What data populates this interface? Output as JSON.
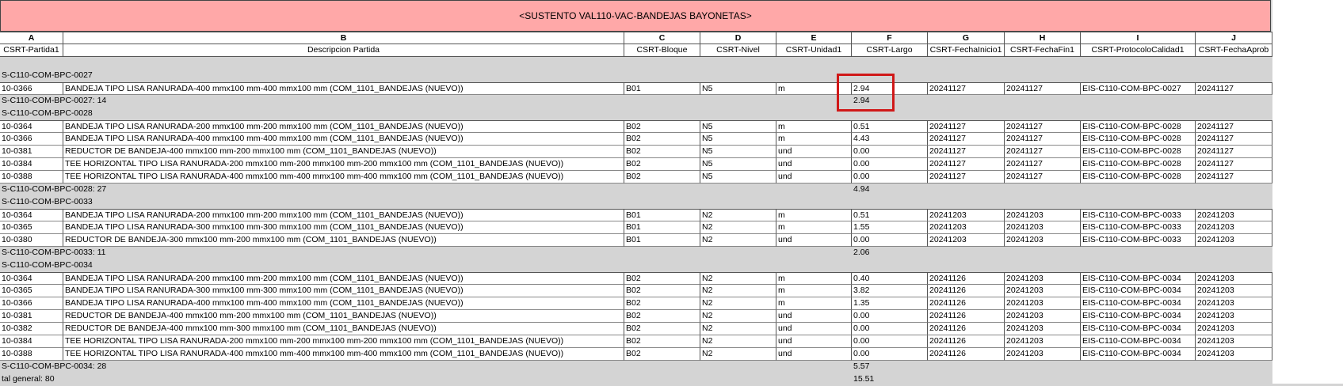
{
  "title": "<SUSTENTO VAL110-VAC-BANDEJAS BAYONETAS>",
  "column_letters": [
    "A",
    "B",
    "C",
    "D",
    "E",
    "F",
    "G",
    "H",
    "I",
    "J"
  ],
  "column_headers": [
    "CSRT-Partida1",
    "Descripcion Partida",
    "CSRT-Bloque",
    "CSRT-Nivel",
    "CSRT-Unidad1",
    "CSRT-Largo",
    "CSRT-FechaInicio1",
    "CSRT-FechaFin1",
    "CSRT-ProtocoloCalidad1",
    "CSRT-FechaAprob"
  ],
  "groups": [
    {
      "header": "S-C110-COM-BPC-0027",
      "rows": [
        [
          "10-0366",
          "BANDEJA TIPO LISA RANURADA-400 mmx100 mm-400 mmx100 mm (COM_1101_BANDEJAS (NUEVO))",
          "B01",
          "N5",
          "m",
          "2.94",
          "20241127",
          "20241127",
          "EIS-C110-COM-BPC-0027",
          "20241127"
        ]
      ],
      "subtotal_label": "S-C110-COM-BPC-0027: 14",
      "subtotal_value": "2.94"
    },
    {
      "header": "S-C110-COM-BPC-0028",
      "rows": [
        [
          "10-0364",
          "BANDEJA TIPO LISA RANURADA-200 mmx100 mm-200 mmx100 mm (COM_1101_BANDEJAS (NUEVO))",
          "B02",
          "N5",
          "m",
          "0.51",
          "20241127",
          "20241127",
          "EIS-C110-COM-BPC-0028",
          "20241127"
        ],
        [
          "10-0366",
          "BANDEJA TIPO LISA RANURADA-400 mmx100 mm-400 mmx100 mm (COM_1101_BANDEJAS (NUEVO))",
          "B02",
          "N5",
          "m",
          "4.43",
          "20241127",
          "20241127",
          "EIS-C110-COM-BPC-0028",
          "20241127"
        ],
        [
          "10-0381",
          "REDUCTOR DE BANDEJA-400 mmx100 mm-200 mmx100 mm (COM_1101_BANDEJAS (NUEVO))",
          "B02",
          "N5",
          "und",
          "0.00",
          "20241127",
          "20241127",
          "EIS-C110-COM-BPC-0028",
          "20241127"
        ],
        [
          "10-0384",
          "TEE HORIZONTAL TIPO LISA RANURADA-200 mmx100 mm-200 mmx100 mm-200 mmx100 mm (COM_1101_BANDEJAS (NUEVO))",
          "B02",
          "N5",
          "und",
          "0.00",
          "20241127",
          "20241127",
          "EIS-C110-COM-BPC-0028",
          "20241127"
        ],
        [
          "10-0388",
          "TEE HORIZONTAL TIPO LISA RANURADA-400 mmx100 mm-400 mmx100 mm-400 mmx100 mm (COM_1101_BANDEJAS (NUEVO))",
          "B02",
          "N5",
          "und",
          "0.00",
          "20241127",
          "20241127",
          "EIS-C110-COM-BPC-0028",
          "20241127"
        ]
      ],
      "subtotal_label": "S-C110-COM-BPC-0028: 27",
      "subtotal_value": "4.94"
    },
    {
      "header": "S-C110-COM-BPC-0033",
      "rows": [
        [
          "10-0364",
          "BANDEJA TIPO LISA RANURADA-200 mmx100 mm-200 mmx100 mm (COM_1101_BANDEJAS (NUEVO))",
          "B01",
          "N2",
          "m",
          "0.51",
          "20241203",
          "20241203",
          "EIS-C110-COM-BPC-0033",
          "20241203"
        ],
        [
          "10-0365",
          "BANDEJA TIPO LISA RANURADA-300 mmx100 mm-300 mmx100 mm (COM_1101_BANDEJAS (NUEVO))",
          "B01",
          "N2",
          "m",
          "1.55",
          "20241203",
          "20241203",
          "EIS-C110-COM-BPC-0033",
          "20241203"
        ],
        [
          "10-0380",
          "REDUCTOR DE BANDEJA-300 mmx100 mm-200 mmx100 mm (COM_1101_BANDEJAS (NUEVO))",
          "B01",
          "N2",
          "und",
          "0.00",
          "20241203",
          "20241203",
          "EIS-C110-COM-BPC-0033",
          "20241203"
        ]
      ],
      "subtotal_label": "S-C110-COM-BPC-0033: 11",
      "subtotal_value": "2.06"
    },
    {
      "header": "S-C110-COM-BPC-0034",
      "rows": [
        [
          "10-0364",
          "BANDEJA TIPO LISA RANURADA-200 mmx100 mm-200 mmx100 mm (COM_1101_BANDEJAS (NUEVO))",
          "B02",
          "N2",
          "m",
          "0.40",
          "20241126",
          "20241203",
          "EIS-C110-COM-BPC-0034",
          "20241203"
        ],
        [
          "10-0365",
          "BANDEJA TIPO LISA RANURADA-300 mmx100 mm-300 mmx100 mm (COM_1101_BANDEJAS (NUEVO))",
          "B02",
          "N2",
          "m",
          "3.82",
          "20241126",
          "20241203",
          "EIS-C110-COM-BPC-0034",
          "20241203"
        ],
        [
          "10-0366",
          "BANDEJA TIPO LISA RANURADA-400 mmx100 mm-400 mmx100 mm (COM_1101_BANDEJAS (NUEVO))",
          "B02",
          "N2",
          "m",
          "1.35",
          "20241126",
          "20241203",
          "EIS-C110-COM-BPC-0034",
          "20241203"
        ],
        [
          "10-0381",
          "REDUCTOR DE BANDEJA-400 mmx100 mm-200 mmx100 mm (COM_1101_BANDEJAS (NUEVO))",
          "B02",
          "N2",
          "und",
          "0.00",
          "20241126",
          "20241203",
          "EIS-C110-COM-BPC-0034",
          "20241203"
        ],
        [
          "10-0382",
          "REDUCTOR DE BANDEJA-400 mmx100 mm-300 mmx100 mm (COM_1101_BANDEJAS (NUEVO))",
          "B02",
          "N2",
          "und",
          "0.00",
          "20241126",
          "20241203",
          "EIS-C110-COM-BPC-0034",
          "20241203"
        ],
        [
          "10-0384",
          "TEE HORIZONTAL TIPO LISA RANURADA-200 mmx100 mm-200 mmx100 mm-200 mmx100 mm (COM_1101_BANDEJAS (NUEVO))",
          "B02",
          "N2",
          "und",
          "0.00",
          "20241126",
          "20241203",
          "EIS-C110-COM-BPC-0034",
          "20241203"
        ],
        [
          "10-0388",
          "TEE HORIZONTAL TIPO LISA RANURADA-400 mmx100 mm-400 mmx100 mm-400 mmx100 mm (COM_1101_BANDEJAS (NUEVO))",
          "B02",
          "N2",
          "und",
          "0.00",
          "20241126",
          "20241203",
          "EIS-C110-COM-BPC-0034",
          "20241203"
        ]
      ],
      "subtotal_label": "S-C110-COM-BPC-0034: 28",
      "subtotal_value": "5.57"
    }
  ],
  "grand_total_label": "tal general: 80",
  "grand_total_value": "15.51",
  "highlight_color": "#d01818",
  "title_bg": "#ffa8a8"
}
